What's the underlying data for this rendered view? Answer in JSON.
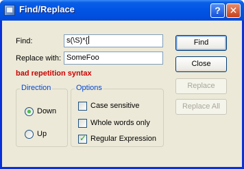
{
  "window": {
    "title": "Find/Replace",
    "help_glyph": "?",
    "close_glyph": "✕"
  },
  "form": {
    "find_label": "Find:",
    "find_value": "s(\\S)*{",
    "replace_label": "Replace with:",
    "replace_value": "SomeFoo",
    "error_message": "bad repetition syntax"
  },
  "direction": {
    "title": "Direction",
    "options": [
      {
        "label": "Down",
        "selected": true
      },
      {
        "label": "Up",
        "selected": false
      }
    ]
  },
  "options": {
    "title": "Options",
    "items": [
      {
        "label": "Case sensitive",
        "checked": false
      },
      {
        "label": "Whole words only",
        "checked": false
      },
      {
        "label": "Regular Expression",
        "checked": true
      }
    ]
  },
  "buttons": {
    "find": "Find",
    "close": "Close",
    "replace": "Replace",
    "replace_all": "Replace All"
  }
}
